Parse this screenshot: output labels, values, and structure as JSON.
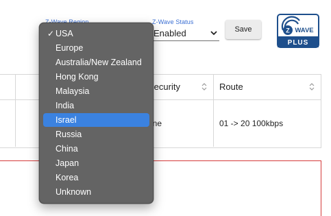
{
  "header": {
    "region_label": "Z-Wave Region",
    "status_label": "Z-Wave Status",
    "status_value": "Enabled",
    "save_label": "Save"
  },
  "logo": {
    "top_text": "Z WAVE",
    "bottom_text": "PLUS"
  },
  "table": {
    "columns": [
      "Security",
      "Route"
    ],
    "rows": [
      {
        "security": "one",
        "route": "01 -> 20 100kbps"
      }
    ]
  },
  "region_dropdown": {
    "selected": "USA",
    "highlighted": "Israel",
    "options": [
      "USA",
      "Europe",
      "Australia/New Zealand",
      "Hong Kong",
      "Malaysia",
      "India",
      "Israel",
      "Russia",
      "China",
      "Japan",
      "Korea",
      "Unknown"
    ]
  },
  "colors": {
    "accent": "#3b6fd3",
    "highlight": "#3b82e0",
    "dropdown_bg": "#646464",
    "logo_blue": "#1e4f8c",
    "alert_border": "#d43a3a"
  }
}
